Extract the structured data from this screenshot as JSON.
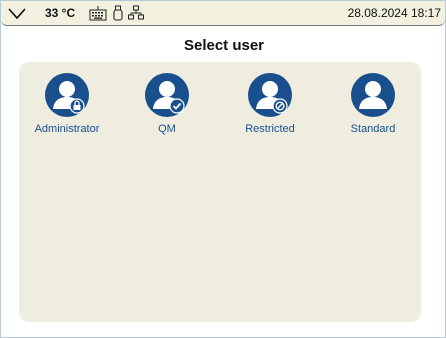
{
  "status": {
    "temperature": "33 °C",
    "datetime": "28.08.2024 18:17",
    "icons": [
      "chevron-down-icon",
      "keyboard-icon",
      "usb-icon",
      "network-icon"
    ]
  },
  "title": "Select user",
  "colors": {
    "accent": "#1a4f8e",
    "panel": "#efede0",
    "statusbar": "#f2f0df"
  },
  "users": [
    {
      "label": "Administrator",
      "badge": "lock-icon"
    },
    {
      "label": "QM",
      "badge": "check-icon"
    },
    {
      "label": "Restricted",
      "badge": "prohibited-icon"
    },
    {
      "label": "Standard",
      "badge": ""
    }
  ]
}
